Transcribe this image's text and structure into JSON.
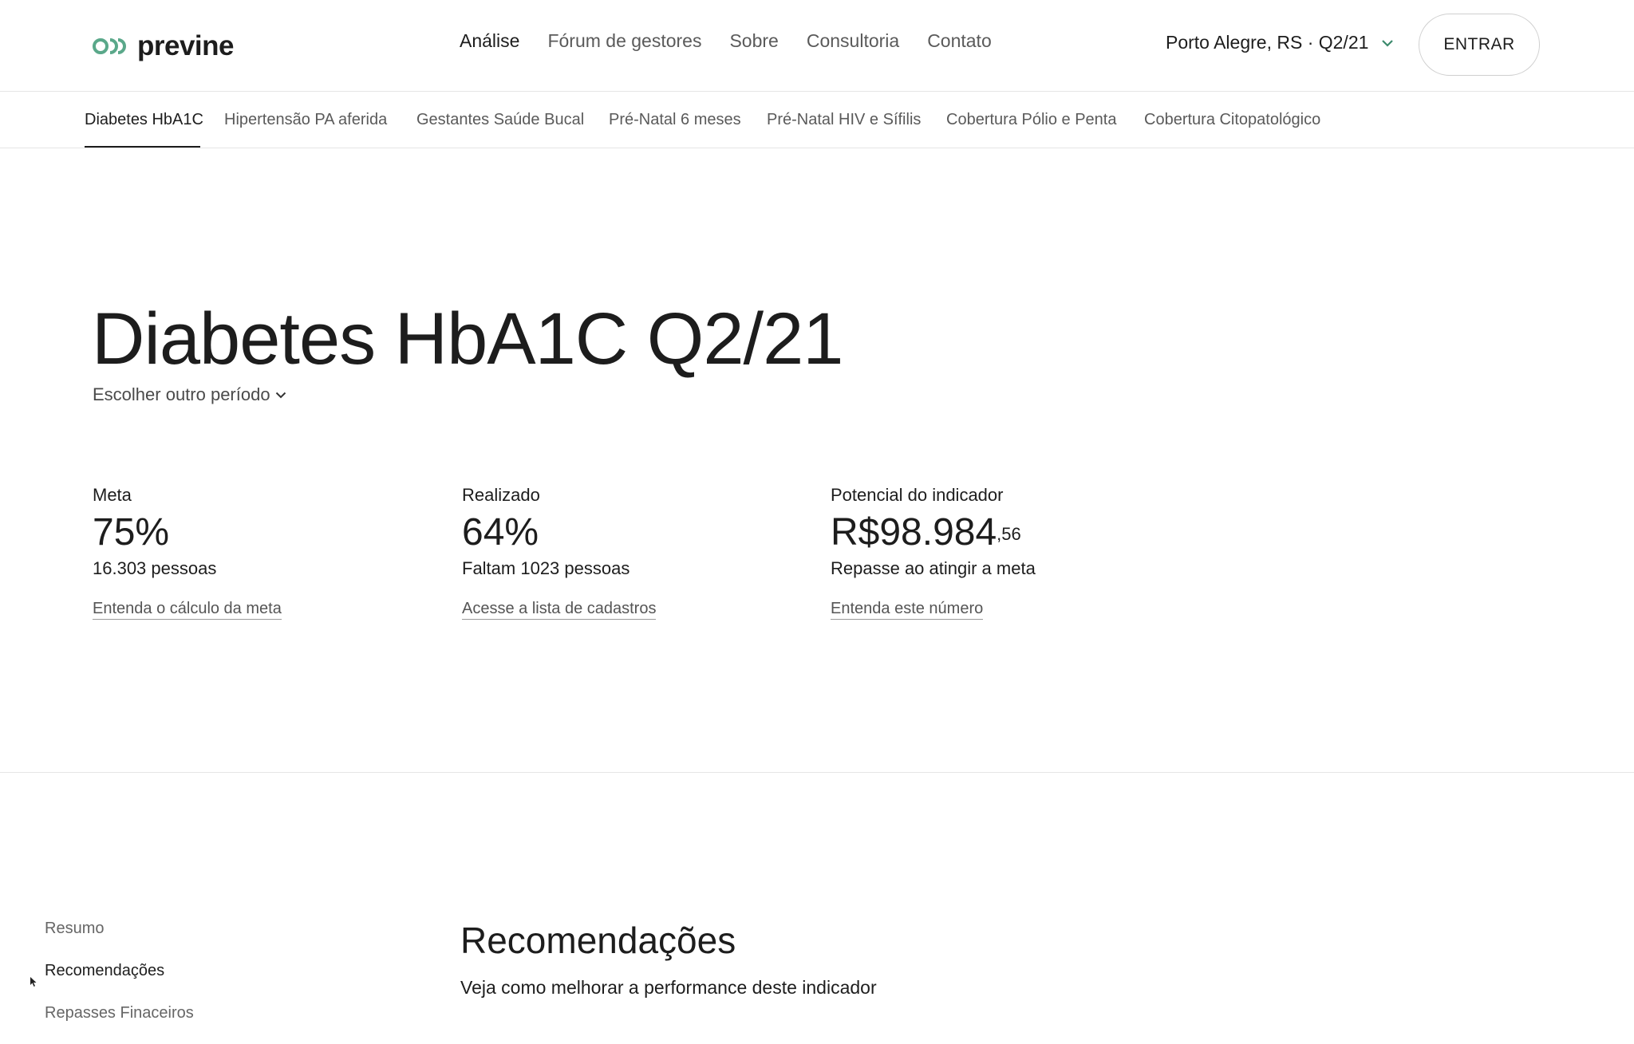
{
  "brand": {
    "name": "previne",
    "accent": "#5aa88a"
  },
  "nav": {
    "items": [
      "Análise",
      "Fórum de gestores",
      "Sobre",
      "Consultoria",
      "Contato"
    ],
    "active_index": 0
  },
  "location": {
    "label": "Porto Alegre, RS · Q2/21"
  },
  "login": {
    "label": "ENTRAR"
  },
  "tabs": {
    "items": [
      "Diabetes HbA1C",
      "Hipertensão PA aferida",
      "Gestantes Saúde Bucal",
      "Pré-Natal 6 meses",
      "Pré-Natal HIV e Sífilis",
      "Cobertura Pólio e Penta",
      "Cobertura Citopatológico"
    ],
    "active_index": 0
  },
  "page": {
    "title": "Diabetes HbA1C Q2/21",
    "period_label": "Escolher outro período"
  },
  "metrics": [
    {
      "label": "Meta",
      "value": "75%",
      "cents": "",
      "sub": "16.303 pessoas",
      "link": "Entenda o cálculo da meta"
    },
    {
      "label": "Realizado",
      "value": "64%",
      "cents": "",
      "sub": "Faltam 1023 pessoas",
      "link": "Acesse a lista de cadastros"
    },
    {
      "label": "Potencial do indicador",
      "value": "R$98.984",
      "cents": ",56",
      "sub": "Repasse ao atingir a meta",
      "link": "Entenda este número"
    }
  ],
  "side_nav": {
    "items": [
      "Resumo",
      "Recomendações",
      "Repasses Finaceiros"
    ],
    "active_index": 1
  },
  "recommendations": {
    "title": "Recomendações",
    "subtitle": "Veja como melhorar a performance deste indicador"
  }
}
